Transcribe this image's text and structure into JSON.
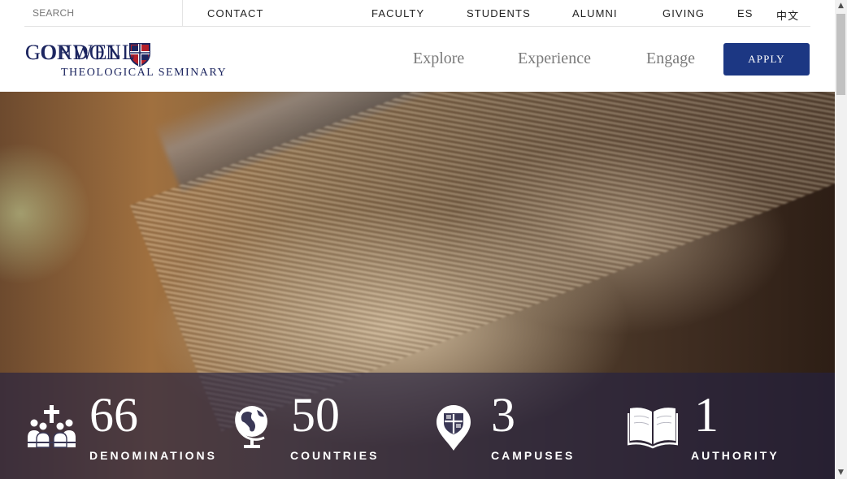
{
  "utility_bar": {
    "search_placeholder": "SEARCH",
    "contact": "CONTACT",
    "links": [
      "FACULTY",
      "STUDENTS",
      "ALUMNI",
      "GIVING",
      "ES",
      "中文"
    ]
  },
  "logo": {
    "line1_left": "GORDON",
    "line1_right": "CONWELL",
    "line2": "THEOLOGICAL SEMINARY"
  },
  "main_nav": [
    "Explore",
    "Experience",
    "Engage"
  ],
  "apply_label": "APPLY",
  "stats": [
    {
      "number": "66",
      "label": "DENOMINATIONS",
      "icon": "congregation-cross-icon"
    },
    {
      "number": "50",
      "label": "COUNTRIES",
      "icon": "globe-icon"
    },
    {
      "number": "3",
      "label": "CAMPUSES",
      "icon": "shield-location-pin-icon"
    },
    {
      "number": "1",
      "label": "AUTHORITY",
      "icon": "open-book-icon"
    }
  ],
  "colors": {
    "brand_navy": "#1d2660",
    "apply_button": "#1c3783",
    "band_overlay": "#242242"
  }
}
